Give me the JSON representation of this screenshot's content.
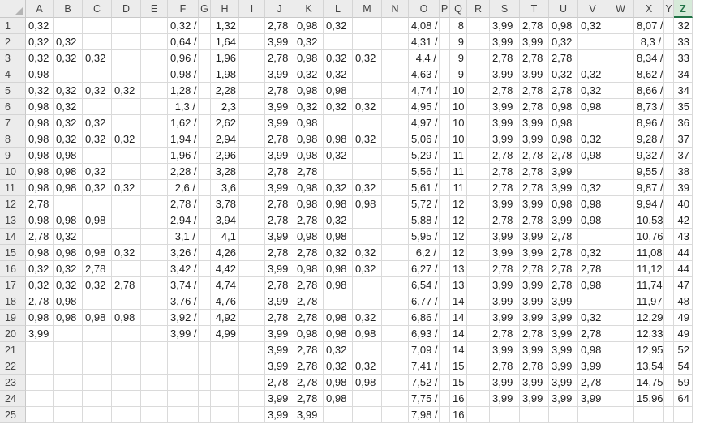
{
  "columns": [
    "A",
    "B",
    "C",
    "D",
    "E",
    "F",
    "G",
    "H",
    "I",
    "J",
    "K",
    "L",
    "M",
    "N",
    "O",
    "P",
    "Q",
    "R",
    "S",
    "T",
    "U",
    "V",
    "W",
    "X",
    "Y",
    "Z"
  ],
  "selected_column": "Z",
  "rows": [
    [
      "0,32",
      "",
      "",
      "",
      "",
      "0,32 /",
      "",
      "1,32",
      "",
      "2,78",
      "0,98",
      "0,32",
      "",
      "",
      "4,08 /",
      "",
      "8",
      "",
      "3,99",
      "2,78",
      "0,98",
      "0,32",
      "",
      "8,07 /",
      "",
      "32"
    ],
    [
      "0,32",
      "0,32",
      "",
      "",
      "",
      "0,64 /",
      "",
      "1,64",
      "",
      "3,99",
      "0,32",
      "",
      "",
      "",
      "4,31 /",
      "",
      "9",
      "",
      "3,99",
      "3,99",
      "0,32",
      "",
      "",
      "8,3 /",
      "",
      "33"
    ],
    [
      "0,32",
      "0,32",
      "0,32",
      "",
      "",
      "0,96 /",
      "",
      "1,96",
      "",
      "2,78",
      "0,98",
      "0,32",
      "0,32",
      "",
      "4,4 /",
      "",
      "9",
      "",
      "2,78",
      "2,78",
      "2,78",
      "",
      "",
      "8,34 /",
      "",
      "33"
    ],
    [
      "0,98",
      "",
      "",
      "",
      "",
      "0,98 /",
      "",
      "1,98",
      "",
      "3,99",
      "0,32",
      "0,32",
      "",
      "",
      "4,63 /",
      "",
      "9",
      "",
      "3,99",
      "3,99",
      "0,32",
      "0,32",
      "",
      "8,62 /",
      "",
      "34"
    ],
    [
      "0,32",
      "0,32",
      "0,32",
      "0,32",
      "",
      "1,28 /",
      "",
      "2,28",
      "",
      "2,78",
      "0,98",
      "0,98",
      "",
      "",
      "4,74 /",
      "",
      "10",
      "",
      "2,78",
      "2,78",
      "2,78",
      "0,32",
      "",
      "8,66 /",
      "",
      "34"
    ],
    [
      "0,98",
      "0,32",
      "",
      "",
      "",
      "1,3 /",
      "",
      "2,3",
      "",
      "3,99",
      "0,32",
      "0,32",
      "0,32",
      "",
      "4,95 /",
      "",
      "10",
      "",
      "3,99",
      "2,78",
      "0,98",
      "0,98",
      "",
      "8,73 /",
      "",
      "35"
    ],
    [
      "0,98",
      "0,32",
      "0,32",
      "",
      "",
      "1,62 /",
      "",
      "2,62",
      "",
      "3,99",
      "0,98",
      "",
      "",
      "",
      "4,97 /",
      "",
      "10",
      "",
      "3,99",
      "3,99",
      "0,98",
      "",
      "",
      "8,96 /",
      "",
      "36"
    ],
    [
      "0,98",
      "0,32",
      "0,32",
      "0,32",
      "",
      "1,94 /",
      "",
      "2,94",
      "",
      "2,78",
      "0,98",
      "0,98",
      "0,32",
      "",
      "5,06 /",
      "",
      "10",
      "",
      "3,99",
      "3,99",
      "0,98",
      "0,32",
      "",
      "9,28 /",
      "",
      "37"
    ],
    [
      "0,98",
      "0,98",
      "",
      "",
      "",
      "1,96 /",
      "",
      "2,96",
      "",
      "3,99",
      "0,98",
      "0,32",
      "",
      "",
      "5,29 /",
      "",
      "11",
      "",
      "2,78",
      "2,78",
      "2,78",
      "0,98",
      "",
      "9,32 /",
      "",
      "37"
    ],
    [
      "0,98",
      "0,98",
      "0,32",
      "",
      "",
      "2,28 /",
      "",
      "3,28",
      "",
      "2,78",
      "2,78",
      "",
      "",
      "",
      "5,56 /",
      "",
      "11",
      "",
      "2,78",
      "2,78",
      "3,99",
      "",
      "",
      "9,55 /",
      "",
      "38"
    ],
    [
      "0,98",
      "0,98",
      "0,32",
      "0,32",
      "",
      "2,6 /",
      "",
      "3,6",
      "",
      "3,99",
      "0,98",
      "0,32",
      "0,32",
      "",
      "5,61 /",
      "",
      "11",
      "",
      "2,78",
      "2,78",
      "3,99",
      "0,32",
      "",
      "9,87 /",
      "",
      "39"
    ],
    [
      "2,78",
      "",
      "",
      "",
      "",
      "2,78 /",
      "",
      "3,78",
      "",
      "2,78",
      "0,98",
      "0,98",
      "0,98",
      "",
      "5,72 /",
      "",
      "12",
      "",
      "3,99",
      "3,99",
      "0,98",
      "0,98",
      "",
      "9,94 /",
      "",
      "40"
    ],
    [
      "0,98",
      "0,98",
      "0,98",
      "",
      "",
      "2,94 /",
      "",
      "3,94",
      "",
      "2,78",
      "2,78",
      "0,32",
      "",
      "",
      "5,88 /",
      "",
      "12",
      "",
      "2,78",
      "2,78",
      "3,99",
      "0,98",
      "",
      "10,53 /",
      "",
      "42"
    ],
    [
      "2,78",
      "0,32",
      "",
      "",
      "",
      "3,1 /",
      "",
      "4,1",
      "",
      "3,99",
      "0,98",
      "0,98",
      "",
      "",
      "5,95 /",
      "",
      "12",
      "",
      "3,99",
      "3,99",
      "2,78",
      "",
      "",
      "10,76 /",
      "",
      "43"
    ],
    [
      "0,98",
      "0,98",
      "0,98",
      "0,32",
      "",
      "3,26 /",
      "",
      "4,26",
      "",
      "2,78",
      "2,78",
      "0,32",
      "0,32",
      "",
      "6,2 /",
      "",
      "12",
      "",
      "3,99",
      "3,99",
      "2,78",
      "0,32",
      "",
      "11,08 /",
      "",
      "44"
    ],
    [
      "0,32",
      "0,32",
      "2,78",
      "",
      "",
      "3,42 /",
      "",
      "4,42",
      "",
      "3,99",
      "0,98",
      "0,98",
      "0,32",
      "",
      "6,27 /",
      "",
      "13",
      "",
      "2,78",
      "2,78",
      "2,78",
      "2,78",
      "",
      "11,12 /",
      "",
      "44"
    ],
    [
      "0,32",
      "0,32",
      "0,32",
      "2,78",
      "",
      "3,74 /",
      "",
      "4,74",
      "",
      "2,78",
      "2,78",
      "0,98",
      "",
      "",
      "6,54 /",
      "",
      "13",
      "",
      "3,99",
      "3,99",
      "2,78",
      "0,98",
      "",
      "11,74 /",
      "",
      "47"
    ],
    [
      "2,78",
      "0,98",
      "",
      "",
      "",
      "3,76 /",
      "",
      "4,76",
      "",
      "3,99",
      "2,78",
      "",
      "",
      "",
      "6,77 /",
      "",
      "14",
      "",
      "3,99",
      "3,99",
      "3,99",
      "",
      "",
      "11,97 /",
      "",
      "48"
    ],
    [
      "0,98",
      "0,98",
      "0,98",
      "0,98",
      "",
      "3,92 /",
      "",
      "4,92",
      "",
      "2,78",
      "2,78",
      "0,98",
      "0,32",
      "",
      "6,86 /",
      "",
      "14",
      "",
      "3,99",
      "3,99",
      "3,99",
      "0,32",
      "",
      "12,29 /",
      "",
      "49"
    ],
    [
      "3,99",
      "",
      "",
      "",
      "",
      "3,99 /",
      "",
      "4,99",
      "",
      "3,99",
      "0,98",
      "0,98",
      "0,98",
      "",
      "6,93 /",
      "",
      "14",
      "",
      "2,78",
      "2,78",
      "3,99",
      "2,78",
      "",
      "12,33 /",
      "",
      "49"
    ],
    [
      "",
      "",
      "",
      "",
      "",
      "",
      "",
      "",
      "",
      "3,99",
      "2,78",
      "0,32",
      "",
      "",
      "7,09 /",
      "",
      "14",
      "",
      "3,99",
      "3,99",
      "3,99",
      "0,98",
      "",
      "12,95 /",
      "",
      "52"
    ],
    [
      "",
      "",
      "",
      "",
      "",
      "",
      "",
      "",
      "",
      "3,99",
      "2,78",
      "0,32",
      "0,32",
      "",
      "7,41 /",
      "",
      "15",
      "",
      "2,78",
      "2,78",
      "3,99",
      "3,99",
      "",
      "13,54 /",
      "",
      "54"
    ],
    [
      "",
      "",
      "",
      "",
      "",
      "",
      "",
      "",
      "",
      "2,78",
      "2,78",
      "0,98",
      "0,98",
      "",
      "7,52 /",
      "",
      "15",
      "",
      "3,99",
      "3,99",
      "3,99",
      "2,78",
      "",
      "14,75 /",
      "",
      "59"
    ],
    [
      "",
      "",
      "",
      "",
      "",
      "",
      "",
      "",
      "",
      "3,99",
      "2,78",
      "0,98",
      "",
      "",
      "7,75 /",
      "",
      "16",
      "",
      "3,99",
      "3,99",
      "3,99",
      "3,99",
      "",
      "15,96 /",
      "",
      "64"
    ],
    [
      "",
      "",
      "",
      "",
      "",
      "",
      "",
      "",
      "",
      "3,99",
      "3,99",
      "",
      "",
      "",
      "7,98 /",
      "",
      "16",
      "",
      "",
      "",
      "",
      "",
      "",
      "",
      "",
      ""
    ]
  ]
}
